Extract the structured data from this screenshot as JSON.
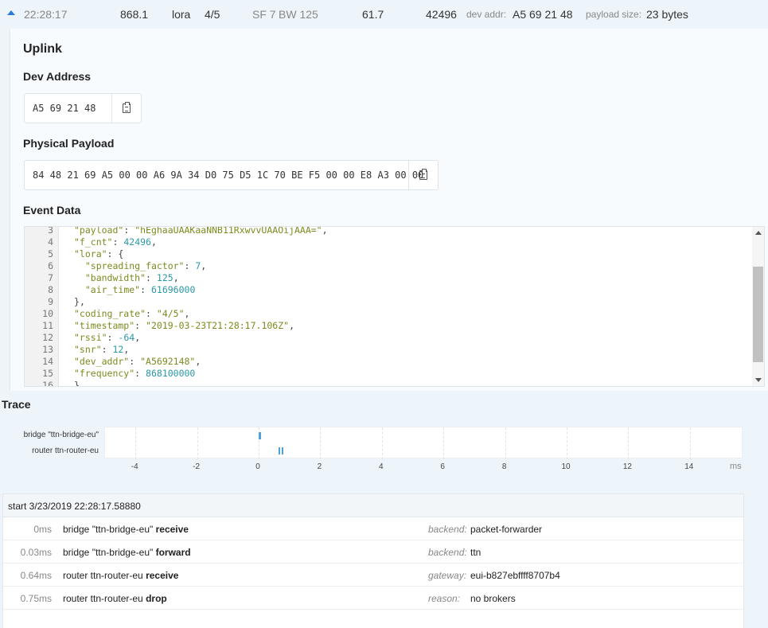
{
  "summary": {
    "time": "22:28:17",
    "frequency": "868.1",
    "modulation": "lora",
    "coding_rate": "4/5",
    "sf": "SF 7",
    "bw": "BW 125",
    "airtime": "61.7",
    "counter": "42496",
    "dev_addr_label": "dev addr:",
    "dev_addr": "A5 69 21 48",
    "payload_size_label": "payload size:",
    "payload_size": "23 bytes"
  },
  "uplink": {
    "title": "Uplink",
    "dev_address_label": "Dev Address",
    "dev_address": "A5 69 21 48",
    "physical_payload_label": "Physical Payload",
    "physical_payload": "84 48 21 69 A5 00 00 A6 9A 34 D0 75 D5 1C 70 BE F5 00 00 E8 A3 00 00",
    "event_data_label": "Event Data"
  },
  "code": [
    {
      "ln": "3",
      "text": "\"payload\": \"hEghaaUAAKaaNNB11RxwvvUAAOijAAA=\","
    },
    {
      "ln": "4",
      "text": "\"f_cnt\": 42496,"
    },
    {
      "ln": "5",
      "text": "\"lora\": {"
    },
    {
      "ln": "6",
      "text": "  \"spreading_factor\": 7,"
    },
    {
      "ln": "7",
      "text": "  \"bandwidth\": 125,"
    },
    {
      "ln": "8",
      "text": "  \"air_time\": 61696000"
    },
    {
      "ln": "9",
      "text": "},"
    },
    {
      "ln": "10",
      "text": "\"coding_rate\": \"4/5\","
    },
    {
      "ln": "11",
      "text": "\"timestamp\": \"2019-03-23T21:28:17.106Z\","
    },
    {
      "ln": "12",
      "text": "\"rssi\": -64,"
    },
    {
      "ln": "13",
      "text": "\"snr\": 12,"
    },
    {
      "ln": "14",
      "text": "\"dev_addr\": \"A5692148\","
    },
    {
      "ln": "15",
      "text": "\"frequency\": 868100000"
    },
    {
      "ln": "16",
      "text": "}"
    }
  ],
  "trace": {
    "title": "Trace",
    "rows": [
      {
        "label": "bridge \"ttn-bridge-eu\""
      },
      {
        "label": "router ttn-router-eu"
      }
    ],
    "ticks": [
      "-4",
      "-2",
      "0",
      "2",
      "4",
      "6",
      "8",
      "10",
      "12",
      "14"
    ],
    "unit": "ms",
    "events_ms": [
      {
        "row": 0,
        "t": 0
      },
      {
        "row": 0,
        "t": 0.03
      },
      {
        "row": 1,
        "t": 0.64
      },
      {
        "row": 1,
        "t": 0.75
      }
    ]
  },
  "events": {
    "start": "start 3/23/2019 22:28:17.58880",
    "rows": [
      {
        "time": "0ms",
        "actor": "bridge \"ttn-bridge-eu\"",
        "action": "receive",
        "key": "backend:",
        "value": "packet-forwarder"
      },
      {
        "time": "0.03ms",
        "actor": "bridge \"ttn-bridge-eu\"",
        "action": "forward",
        "key": "backend:",
        "value": "ttn"
      },
      {
        "time": "0.64ms",
        "actor": "router ttn-router-eu",
        "action": "receive",
        "key": "gateway:",
        "value": "eui-b827ebffff8707b4"
      },
      {
        "time": "0.75ms",
        "actor": "router ttn-router-eu",
        "action": "drop",
        "key": "reason:",
        "value": "no brokers"
      }
    ]
  }
}
